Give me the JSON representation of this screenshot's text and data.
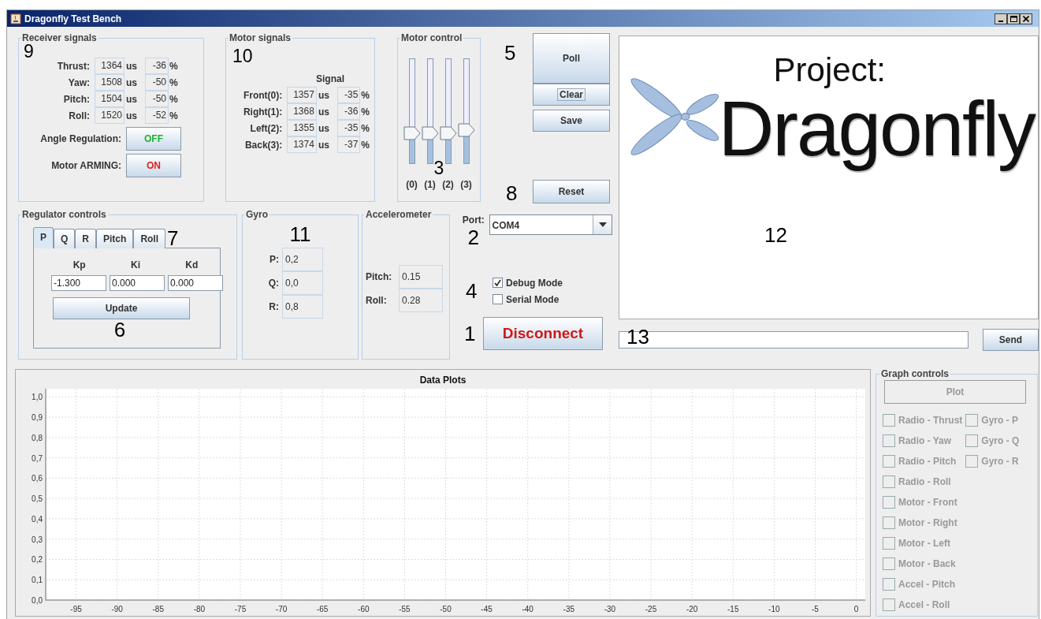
{
  "window": {
    "title": "Dragonfly Test Bench"
  },
  "receiver_signals": {
    "title": "Receiver signals",
    "callout": "9",
    "rows": [
      {
        "label": "Thrust:",
        "value": "1364",
        "unit": "us",
        "percent": "-36",
        "percent_unit": "%"
      },
      {
        "label": "Yaw:",
        "value": "1508",
        "unit": "us",
        "percent": "-50",
        "percent_unit": "%"
      },
      {
        "label": "Pitch:",
        "value": "1504",
        "unit": "us",
        "percent": "-50",
        "percent_unit": "%"
      },
      {
        "label": "Roll:",
        "value": "1520",
        "unit": "us",
        "percent": "-52",
        "percent_unit": "%"
      }
    ],
    "toggles": [
      {
        "label": "Angle Regulation:",
        "value": "OFF",
        "on": false
      },
      {
        "label": "Motor ARMING:",
        "value": "ON",
        "on": true
      }
    ]
  },
  "motor_signals": {
    "title": "Motor signals",
    "callout": "10",
    "column_header": "Signal",
    "rows": [
      {
        "label": "Front(0):",
        "value": "1357",
        "unit": "us",
        "percent": "-35",
        "percent_unit": "%"
      },
      {
        "label": "Right(1):",
        "value": "1368",
        "unit": "us",
        "percent": "-36",
        "percent_unit": "%"
      },
      {
        "label": "Left(2):",
        "value": "1355",
        "unit": "us",
        "percent": "-35",
        "percent_unit": "%"
      },
      {
        "label": "Back(3):",
        "value": "1374",
        "unit": "us",
        "percent": "-37",
        "percent_unit": "%"
      }
    ]
  },
  "motor_control": {
    "title": "Motor control",
    "callout": "3",
    "sliders": [
      {
        "label": "(0)",
        "level": 0.34
      },
      {
        "label": "(1)",
        "level": 0.34
      },
      {
        "label": "(2)",
        "level": 0.34
      },
      {
        "label": "(3)",
        "level": 0.37
      }
    ]
  },
  "action_buttons": {
    "callout": "5",
    "buttons": [
      {
        "label": "Poll",
        "kind": "large",
        "focused": false
      },
      {
        "label": "Clear",
        "kind": "normal",
        "focused": true
      },
      {
        "label": "Save",
        "kind": "normal",
        "focused": false
      }
    ],
    "reset_callout": "8",
    "reset": "Reset"
  },
  "regulator_controls": {
    "title": "Regulator controls",
    "tabs_callout": "7",
    "tabs": [
      {
        "label": "P",
        "selected": true
      },
      {
        "label": "Q",
        "selected": false
      },
      {
        "label": "R",
        "selected": false
      },
      {
        "label": "Pitch",
        "selected": false
      },
      {
        "label": "Roll",
        "selected": false
      }
    ],
    "gains": [
      {
        "label": "Kp",
        "value": "-1.300"
      },
      {
        "label": "Ki",
        "value": "0.000"
      },
      {
        "label": "Kd",
        "value": "0.000"
      }
    ],
    "button": "Update",
    "callout": "6"
  },
  "gyro": {
    "title": "Gyro",
    "callout": "11",
    "rows": [
      {
        "label": "P:",
        "value": "0,2"
      },
      {
        "label": "Q:",
        "value": "0,0"
      },
      {
        "label": "R:",
        "value": "0,8"
      }
    ]
  },
  "accelerometer": {
    "title": "Accelerometer",
    "rows": [
      {
        "label": "Pitch:",
        "value": "0.15"
      },
      {
        "label": "Roll:",
        "value": "0.28"
      }
    ]
  },
  "connection": {
    "port_label": "Port:",
    "port_value": "COM4",
    "port_callout": "2",
    "modes_callout": "4",
    "modes": [
      {
        "label": "Debug Mode",
        "checked": true
      },
      {
        "label": "Serial Mode",
        "checked": false
      }
    ],
    "disconnect_callout": "1",
    "disconnect": "Disconnect"
  },
  "logo_panel": {
    "subtitle": "Project:",
    "title": "Dragonfly",
    "callout": "12"
  },
  "console": {
    "callout": "13",
    "send": "Send"
  },
  "data_plots": {
    "chart_data": {
      "type": "line",
      "title": "Data Plots",
      "grid": true,
      "xlim": [
        -98.7,
        1.1
      ],
      "ylim": [
        0,
        1.04
      ],
      "xticks": [
        -95,
        -90,
        -85,
        -80,
        -75,
        -70,
        -65,
        -60,
        -55,
        -50,
        -45,
        -40,
        -35,
        -30,
        -25,
        -20,
        -15,
        -10,
        -5,
        0
      ],
      "yticks": [
        {
          "value": 0,
          "label": "0,0"
        },
        {
          "value": 0.1,
          "label": "0,1"
        },
        {
          "value": 0.2,
          "label": "0,2"
        },
        {
          "value": 0.3,
          "label": "0,3"
        },
        {
          "value": 0.4,
          "label": "0,4"
        },
        {
          "value": 0.5,
          "label": "0,5"
        },
        {
          "value": 0.6,
          "label": "0,6"
        },
        {
          "value": 0.7,
          "label": "0,7"
        },
        {
          "value": 0.8,
          "label": "0,8"
        },
        {
          "value": 0.9,
          "label": "0,9"
        },
        {
          "value": 1,
          "label": "1,0"
        }
      ]
    }
  },
  "graph_controls": {
    "title": "Graph controls",
    "plot_button": "Plot",
    "disabled": true,
    "columns": [
      {
        "items": [
          {
            "label": "Radio - Thrust",
            "checked": false
          },
          {
            "label": "Radio - Yaw",
            "checked": false
          },
          {
            "label": "Radio - Pitch",
            "checked": false
          },
          {
            "label": "Radio - Roll",
            "checked": false
          },
          {
            "label": "Motor - Front",
            "checked": false
          },
          {
            "label": "Motor - Right",
            "checked": false
          },
          {
            "label": "Motor - Left",
            "checked": false
          },
          {
            "label": "Motor - Back",
            "checked": false
          },
          {
            "label": "Accel - Pitch",
            "checked": false
          },
          {
            "label": "Accel - Roll",
            "checked": false
          }
        ]
      },
      {
        "items": [
          {
            "label": "Gyro - P",
            "checked": false
          },
          {
            "label": "Gyro - Q",
            "checked": false
          },
          {
            "label": "Gyro - R",
            "checked": false
          }
        ]
      }
    ]
  }
}
